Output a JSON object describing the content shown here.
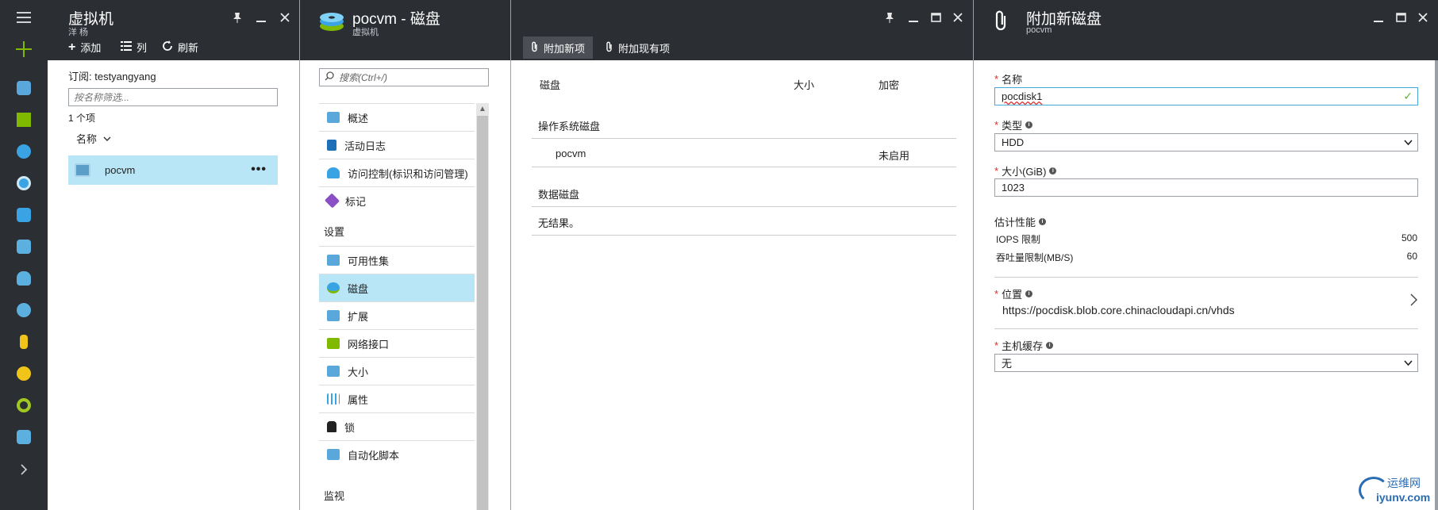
{
  "nav": {
    "menu_icon": "hamburger-icon",
    "new_icon": "plus-icon",
    "items": [
      {
        "name": "nav-cube-icon",
        "color": "#5aa7db"
      },
      {
        "name": "nav-grid-icon",
        "color": "#7fba00"
      },
      {
        "name": "nav-globe-icon",
        "color": "#3aa3e3"
      },
      {
        "name": "nav-clock-icon",
        "color": "#3aa3e3"
      },
      {
        "name": "nav-monitor-icon",
        "color": "#3aa3e3"
      },
      {
        "name": "nav-vm-icon",
        "color": "#5bb0e0"
      },
      {
        "name": "nav-sql-icon",
        "color": "#5bb0e0"
      },
      {
        "name": "nav-cloud-icon",
        "color": "#5bb0e0"
      },
      {
        "name": "nav-key-icon",
        "color": "#f0c419"
      },
      {
        "name": "nav-gauge-icon",
        "color": "#f0c419"
      },
      {
        "name": "nav-circle-icon",
        "color": "#a1c820"
      },
      {
        "name": "nav-vm2-icon",
        "color": "#5bb0e0"
      }
    ],
    "expand_icon": "chevron-right-icon"
  },
  "blade1": {
    "title": "虚拟机",
    "subtitle": "洋 杨",
    "commands": {
      "add": "添加",
      "columns": "列",
      "refresh": "刷新"
    },
    "subscription": "订阅: testyangyang",
    "filter_placeholder": "按名称筛选...",
    "count": "1 个项",
    "sort_label": "名称",
    "rows": [
      {
        "name": "pocvm",
        "more": "•••"
      }
    ]
  },
  "blade2": {
    "title": "pocvm - 磁盘",
    "subtitle": "虚拟机",
    "search_placeholder": "搜索(Ctrl+/)",
    "menu": {
      "overview": "概述",
      "activity_log": "活动日志",
      "access_control": "访问控制(标识和访问管理)",
      "tags": "标记",
      "settings_section": "设置",
      "availability_set": "可用性集",
      "disks": "磁盘",
      "extensions": "扩展",
      "network_interfaces": "网络接口",
      "size": "大小",
      "properties": "属性",
      "locks": "锁",
      "automation_script": "自动化脚本",
      "monitoring_section": "监视"
    },
    "toolbar": {
      "attach_new": "附加新项",
      "attach_existing": "附加现有项"
    },
    "table": {
      "col_disk": "磁盘",
      "col_size": "大小",
      "col_encryption": "加密",
      "os_disk_section": "操作系统磁盘",
      "os_disk_row": {
        "name": "pocvm",
        "encryption": "未启用"
      },
      "data_disk_section": "数据磁盘",
      "no_results": "无结果。"
    }
  },
  "blade3": {
    "title": "附加新磁盘",
    "subtitle": "pocvm",
    "name_label": "名称",
    "name_value": "pocdisk1",
    "type_label": "类型",
    "type_value": "HDD",
    "size_label": "大小(GiB)",
    "size_value": "1023",
    "perf_label": "估计性能",
    "iops_label": "IOPS 限制",
    "iops_value": "500",
    "throughput_label": "吞吐量限制(MB/S)",
    "throughput_value": "60",
    "location_label": "位置",
    "location_value": "https://pocdisk.blob.core.chinacloudapi.cn/vhds",
    "cache_label": "主机缓存",
    "cache_value": "无"
  },
  "watermark": {
    "top": "运维网",
    "bottom": "iyunv.com"
  },
  "colors": {
    "header_bg": "#2b2e33",
    "selected_bg": "#b9e6f7",
    "required": "#d9302c",
    "valid": "#5bb82c"
  }
}
